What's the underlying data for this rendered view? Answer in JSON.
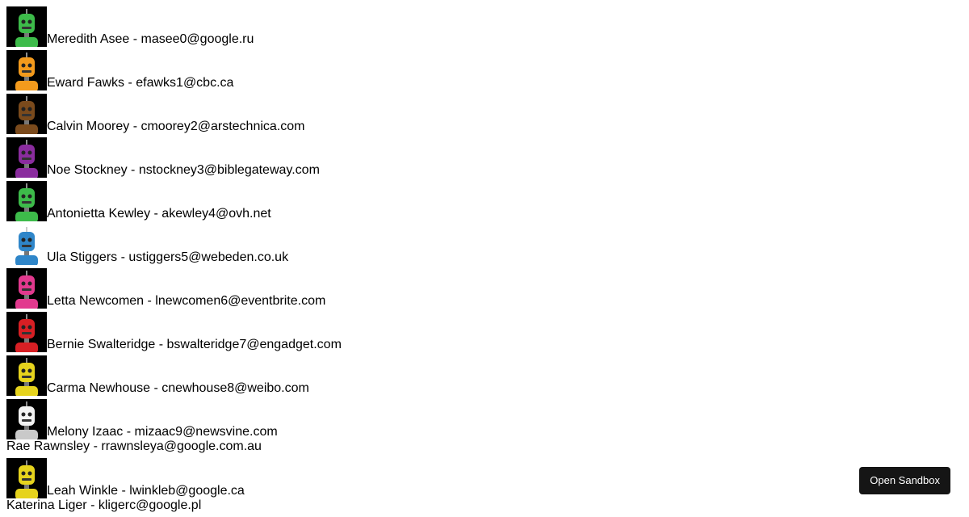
{
  "users": [
    {
      "text": "Meredith Asee - masee0@google.ru",
      "avatar": {
        "icon": "robot-avatar-icon",
        "body": "#3dbb4a",
        "head": "#3dbb4a",
        "bg": "#000000"
      }
    },
    {
      "text": "Eward Fawks - efawks1@cbc.ca",
      "avatar": {
        "icon": "robot-avatar-icon",
        "body": "#f39a1c",
        "head": "#f39a1c",
        "bg": "#000000"
      }
    },
    {
      "text": "Calvin Moorey - cmoorey2@arstechnica.com",
      "avatar": {
        "icon": "robot-avatar-icon",
        "body": "#7a4a1c",
        "head": "#7a4a1c",
        "bg": "#000000"
      }
    },
    {
      "text": "Noe Stockney - nstockney3@biblegateway.com",
      "avatar": {
        "icon": "robot-avatar-icon",
        "body": "#8a2c9e",
        "head": "#8a2c9e",
        "bg": "#000000"
      }
    },
    {
      "text": "Antonietta Kewley - akewley4@ovh.net",
      "avatar": {
        "icon": "robot-avatar-icon",
        "body": "#3dbb4a",
        "head": "#3dbb4a",
        "bg": "#000000"
      }
    },
    {
      "text": "Ula Stiggers - ustiggers5@webeden.co.uk",
      "avatar": {
        "icon": "robot-avatar-icon",
        "body": "#2f86c9",
        "head": "#2f86c9",
        "bg": "#ffffff"
      }
    },
    {
      "text": "Letta Newcomen - lnewcomen6@eventbrite.com",
      "avatar": {
        "icon": "robot-avatar-icon",
        "body": "#e2398e",
        "head": "#e2398e",
        "bg": "#000000"
      }
    },
    {
      "text": "Bernie Swalteridge - bswalteridge7@engadget.com",
      "avatar": {
        "icon": "robot-avatar-icon",
        "body": "#d71f24",
        "head": "#d71f24",
        "bg": "#000000"
      }
    },
    {
      "text": "Carma Newhouse - cnewhouse8@weibo.com",
      "avatar": {
        "icon": "robot-avatar-icon",
        "body": "#e6d31d",
        "head": "#e6d31d",
        "bg": "#000000"
      }
    },
    {
      "text": "Melony Izaac - mizaac9@newsvine.com",
      "avatar": {
        "icon": "robot-avatar-icon",
        "body": "#c9c9c9",
        "head": "#f2f2f2",
        "bg": "#000000"
      }
    },
    {
      "text": "Rae Rawnsley - rrawnsleya@google.com.au",
      "avatar": null
    },
    {
      "text": "Leah Winkle - lwinkleb@google.ca",
      "avatar": {
        "icon": "robot-avatar-icon",
        "body": "#e6d31d",
        "head": "#e6d31d",
        "bg": "#000000"
      }
    },
    {
      "text": "Katerina Liger - kligerc@google.pl",
      "avatar": null
    }
  ],
  "sandbox_button": {
    "label": "Open Sandbox"
  }
}
